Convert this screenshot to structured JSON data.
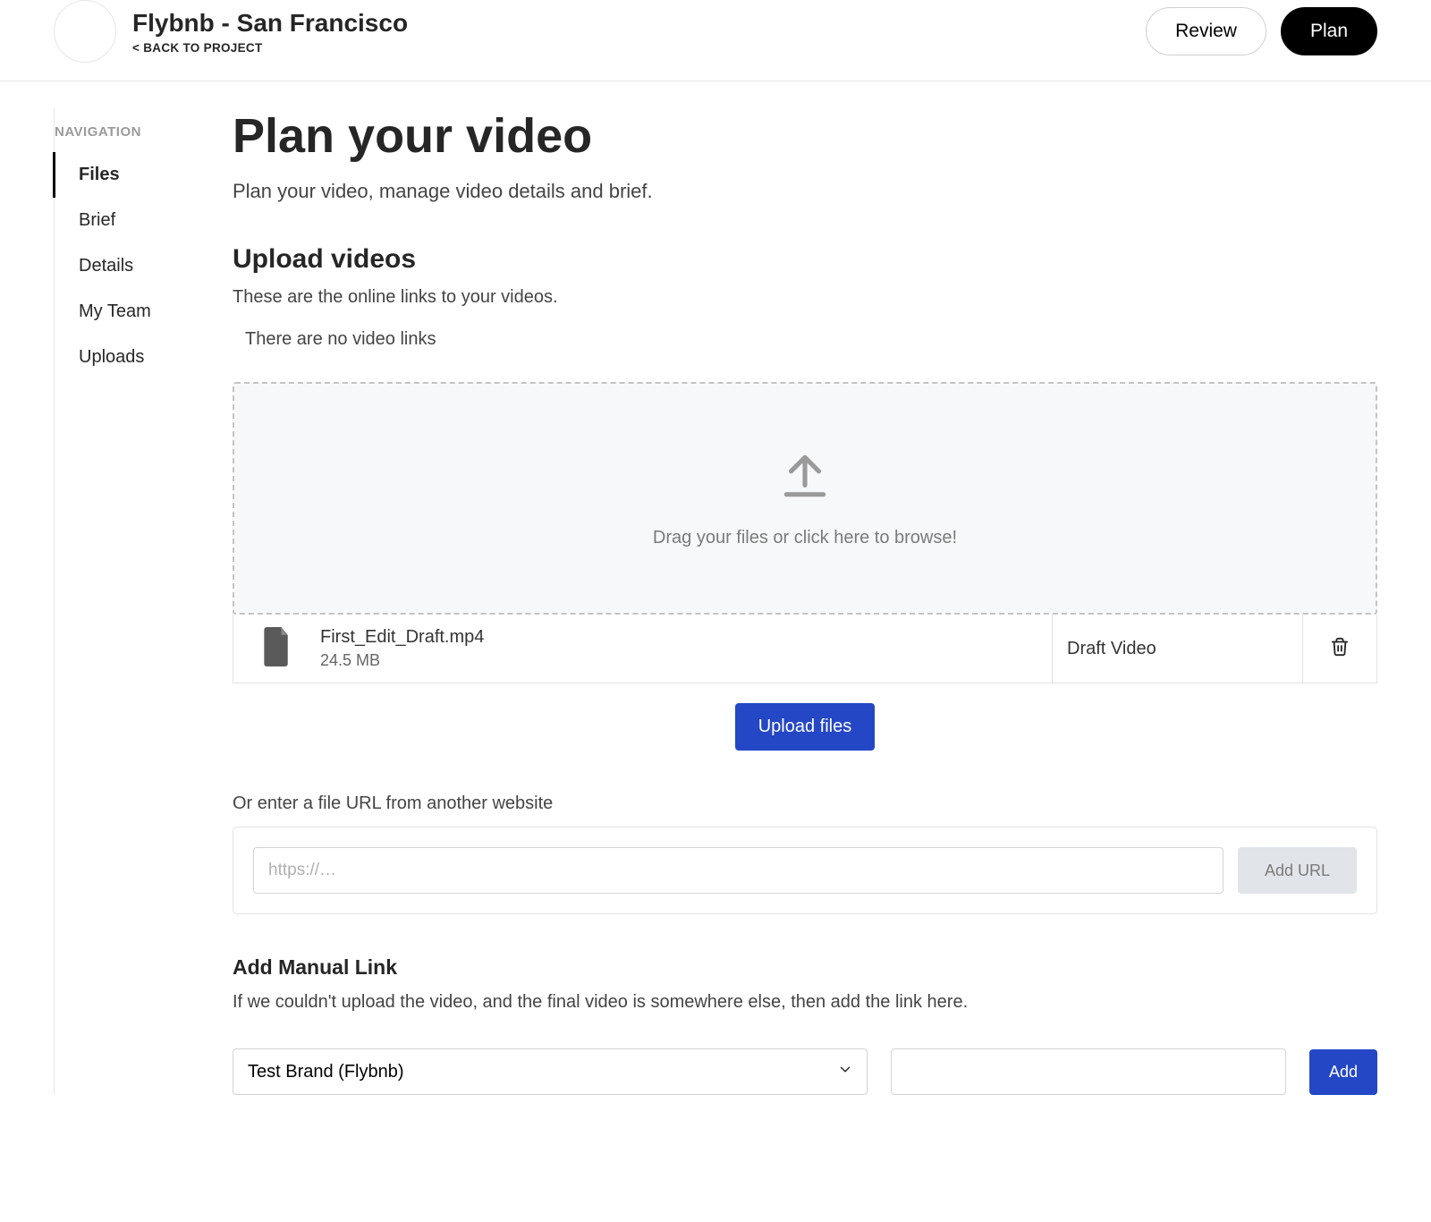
{
  "header": {
    "project_title": "Flybnb - San Francisco",
    "back_link": "< BACK TO PROJECT",
    "review_label": "Review",
    "plan_label": "Plan"
  },
  "sidebar": {
    "heading": "NAVIGATION",
    "items": [
      {
        "label": "Files",
        "active": true
      },
      {
        "label": "Brief",
        "active": false
      },
      {
        "label": "Details",
        "active": false
      },
      {
        "label": "My Team",
        "active": false
      },
      {
        "label": "Uploads",
        "active": false
      }
    ]
  },
  "main": {
    "page_title": "Plan your video",
    "page_sub": "Plan your video, manage video details and brief.",
    "upload_heading": "Upload videos",
    "upload_desc": "These are the online links to your videos.",
    "no_links": "There are no video links",
    "dropzone_text": "Drag your files or click here to browse!",
    "files": [
      {
        "name": "First_Edit_Draft.mp4",
        "size": "24.5 MB",
        "type": "Draft Video"
      }
    ],
    "upload_files_label": "Upload files",
    "url_label": "Or enter a file URL from another website",
    "url_placeholder": "https://…",
    "add_url_label": "Add URL",
    "manual_heading": "Add Manual Link",
    "manual_desc": "If we couldn't upload the video, and the final video is somewhere else, then add the link here.",
    "brand_selected": "Test Brand (Flybnb)",
    "add_manual_label": "Add"
  }
}
